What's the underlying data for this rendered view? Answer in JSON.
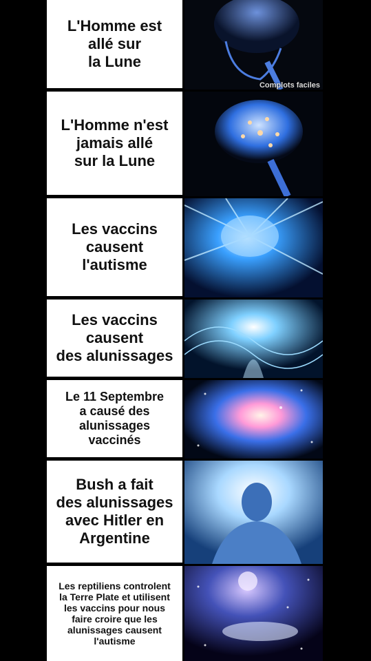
{
  "panels": [
    {
      "text": "L'Homme est\nallé sur\nla Lune",
      "size": 22
    },
    {
      "text": "L'Homme n'est\njamais allé\nsur la Lune",
      "size": 22
    },
    {
      "text": "Les vaccins\ncausent\nl'autisme",
      "size": 22
    },
    {
      "text": "Les vaccins\ncausent\ndes alunissages",
      "size": 22
    },
    {
      "text": "Le 11 Septembre\na causé des\nalunissages\nvaccinés",
      "size": 18
    },
    {
      "text": "Bush a fait\ndes alunissages\navec Hitler en\nArgentine",
      "size": 22
    },
    {
      "text": "Les reptiliens controlent\nla Terre Plate et utilisent\nles vaccins pour nous\nfaire croire que les\nalunissages causent\nl'autisme",
      "size": 14
    }
  ],
  "watermark": "Complots faciles",
  "colors": {
    "brain_blue": "#2f6fe0",
    "glow": "#bfe4ff",
    "text_bg": "#ffffff"
  }
}
